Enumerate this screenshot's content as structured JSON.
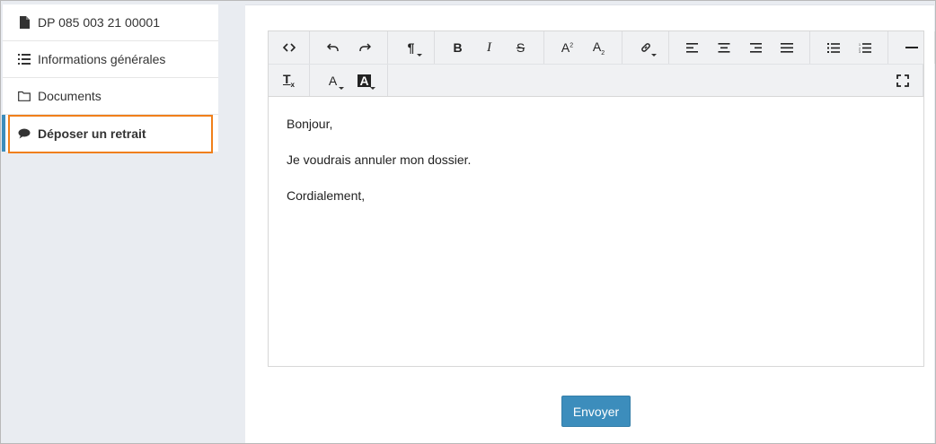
{
  "sidebar": {
    "items": [
      {
        "label": "DP 085 003 21 00001",
        "icon": "file-icon"
      },
      {
        "label": "Informations générales",
        "icon": "list-icon"
      },
      {
        "label": "Documents",
        "icon": "folder-icon"
      },
      {
        "label": "Déposer un retrait",
        "icon": "comment-icon"
      }
    ]
  },
  "editor": {
    "content": {
      "line1": "Bonjour,",
      "line2": "Je voudrais annuler mon dossier.",
      "line3": "Cordialement,"
    },
    "toolbar": {
      "paragraph_glyph": "¶",
      "bold_glyph": "B",
      "italic_glyph": "I",
      "strike_glyph": "S",
      "sup_glyph": "A",
      "sub_glyph": "A",
      "font_color_glyph": "A",
      "highlight_glyph": "A",
      "clear_format_glyph": "T"
    }
  },
  "actions": {
    "send_label": "Envoyer"
  },
  "colors": {
    "accent": "#3c8dbc",
    "highlight_border": "#f07f1a"
  }
}
